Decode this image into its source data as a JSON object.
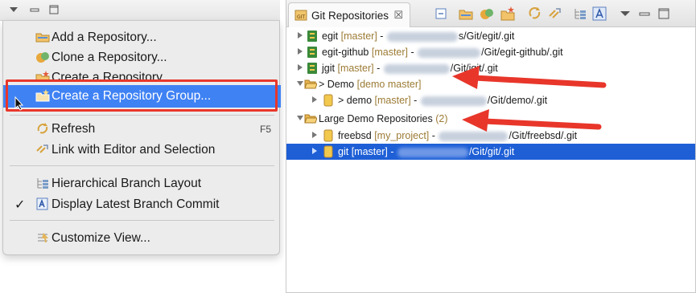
{
  "menu": {
    "items": [
      {
        "label": "Add a Repository...",
        "icon": "add-repository-icon"
      },
      {
        "label": "Clone a Repository...",
        "icon": "clone-repository-icon"
      },
      {
        "label": "Create a Repository...",
        "icon": "create-repository-icon"
      },
      {
        "label": "Create a Repository Group...",
        "icon": "create-group-icon",
        "highlighted": true
      },
      {
        "label": "Refresh",
        "icon": "refresh-icon",
        "accelerator": "F5"
      },
      {
        "label": "Link with Editor and Selection",
        "icon": "link-editor-icon"
      },
      {
        "label": "Hierarchical Branch Layout",
        "icon": "hierarchical-layout-icon"
      },
      {
        "label": "Display Latest Branch Commit",
        "icon": "latest-commit-icon",
        "checked": true
      },
      {
        "label": "Customize View...",
        "icon": "customize-view-icon"
      }
    ]
  },
  "view": {
    "tab_title": "Git Repositories",
    "close_glyph": "☒"
  },
  "tree": {
    "rows": [
      {
        "name": "egit",
        "branch": "[master]",
        "sep": " - ",
        "path": "s/Git/egit/.git"
      },
      {
        "name": "egit-github",
        "branch": "[master]",
        "sep": " - ",
        "path": "/Git/egit-github/.git"
      },
      {
        "name": "jgit",
        "branch": "[master]",
        "sep": " - ",
        "path": "/Git/jgit/.git"
      },
      {
        "name": "> Demo",
        "branch": "[demo master]"
      },
      {
        "name": "> demo",
        "branch": "[master]",
        "sep": " - ",
        "path": "/Git/demo/.git"
      },
      {
        "name": "Large Demo Repositories",
        "branch": "(2)"
      },
      {
        "name": "freebsd",
        "branch": "[my_project]",
        "sep": " - ",
        "path": "/Git/freebsd/.git"
      },
      {
        "name": "git",
        "branch": "[master]",
        "sep": " - ",
        "path": "/Git/git/.git"
      }
    ]
  },
  "colors": {
    "accent": "#e8362a",
    "menu_highlight": "#3f82f4",
    "selection": "#1e5fd6",
    "branch_text": "#9c7b35"
  }
}
